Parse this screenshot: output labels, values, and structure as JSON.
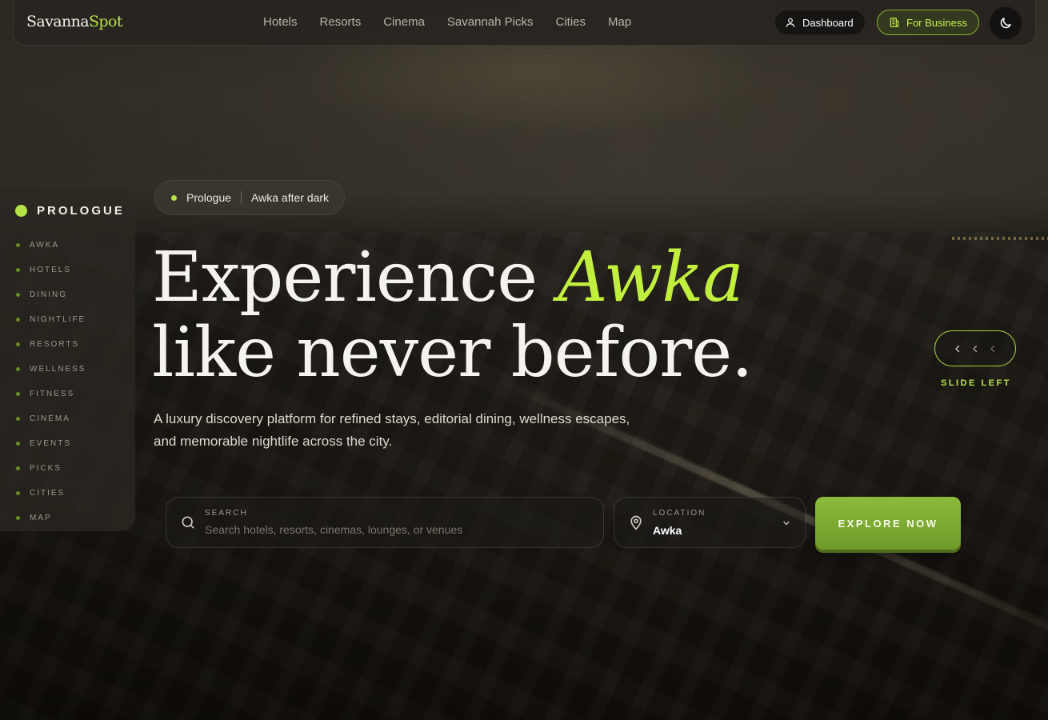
{
  "brand": {
    "name_main": "Savanna",
    "name_accent": "Spot"
  },
  "nav": {
    "links": [
      "Hotels",
      "Resorts",
      "Cinema",
      "Savannah Picks",
      "Cities",
      "Map"
    ],
    "dashboard_label": "Dashboard",
    "business_label": "For Business"
  },
  "rail": {
    "heading": "PROLOGUE",
    "items": [
      "AWKA",
      "HOTELS",
      "DINING",
      "NIGHTLIFE",
      "RESORTS",
      "WELLNESS",
      "FITNESS",
      "CINEMA",
      "EVENTS",
      "PICKS",
      "CITIES",
      "MAP"
    ]
  },
  "hero": {
    "chip_primary": "Prologue",
    "chip_secondary": "Awka after dark",
    "headline_a": "Experience ",
    "headline_accent": "Awka",
    "headline_b": "like never before.",
    "lede": "A luxury discovery platform for refined stays, editorial dining, wellness escapes, and memorable nightlife across the city."
  },
  "search": {
    "label": "SEARCH",
    "placeholder": "Search hotels, resorts, cinemas, lounges, or venues",
    "value": ""
  },
  "location": {
    "label": "LOCATION",
    "value": "Awka"
  },
  "cta": {
    "explore_label": "EXPLORE NOW"
  },
  "slide": {
    "label": "SLIDE LEFT"
  },
  "icons": {
    "search": "search-icon",
    "location": "map-pin-icon",
    "dashboard": "user-icon",
    "business": "building-icon",
    "theme": "moon-icon"
  },
  "colors": {
    "accent": "#b7e34a",
    "cta": "#7fae35",
    "background": "#1f1b16"
  }
}
